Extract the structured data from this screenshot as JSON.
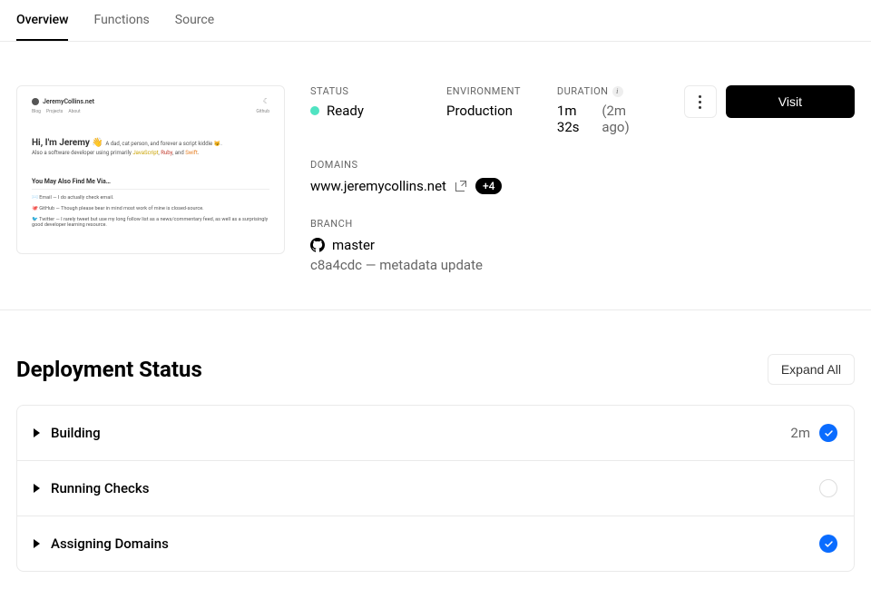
{
  "tabs": {
    "overview": "Overview",
    "functions": "Functions",
    "source": "Source"
  },
  "preview": {
    "site_name": "JeremyCollins.net",
    "nav": {
      "blog": "Blog",
      "projects": "Projects",
      "about": "About",
      "github": "Github"
    },
    "hello": "Hi, I'm Jeremy 👋",
    "hello_sub": "A dad, cat person, and forever a script kiddie 😼.",
    "line2_a": "Also a software developer using primarily ",
    "line2_js": "JavaScript",
    "line2_sep": ", ",
    "line2_rb": "Ruby",
    "line2_and": ", and ",
    "line2_sw": "Swift",
    "line2_end": ".",
    "also_title": "You May Also Find Me Via…",
    "item1": "✉️ Email — I do actually check email.",
    "item2": "🐙 GitHub — Though please bear in mind most work of mine is closed-source.",
    "item3": "🐦 Twitter — I rarely tweet but use my long follow list as a news/commentary feed, as well as a surprisingly good developer learning resource."
  },
  "status_label": "STATUS",
  "status_value": "Ready",
  "env_label": "ENVIRONMENT",
  "env_value": "Production",
  "dur_label": "DURATION",
  "dur_value": "1m 32s",
  "dur_ago": "(2m ago)",
  "visit_label": "Visit",
  "domains_label": "DOMAINS",
  "domain_value": "www.jeremycollins.net",
  "domain_more": "+4",
  "branch_label": "BRANCH",
  "branch_value": "master",
  "commit_hash": "c8a4cdc",
  "commit_sep": " — ",
  "commit_msg": "metadata update",
  "deploy_title": "Deployment Status",
  "expand_label": "Expand All",
  "steps": {
    "building": {
      "label": "Building",
      "time": "2m"
    },
    "checks": {
      "label": "Running Checks"
    },
    "domains": {
      "label": "Assigning Domains"
    }
  }
}
